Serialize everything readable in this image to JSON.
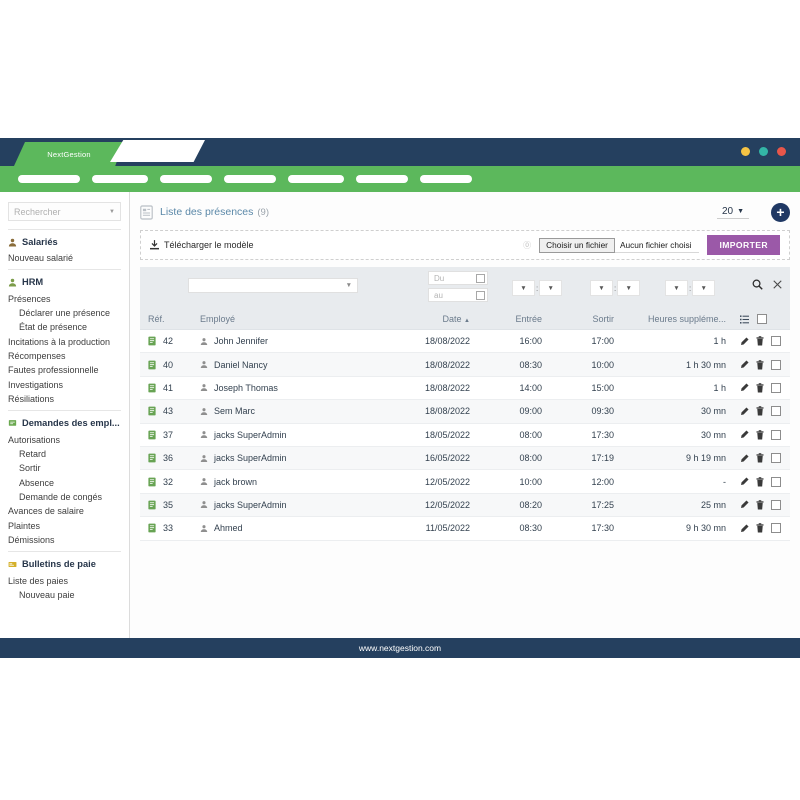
{
  "window": {
    "app_tab_label": "NextGestion",
    "dot_colors": [
      "#f5c344",
      "#33b5a6",
      "#e8564a"
    ],
    "titlebar_color": "#25405f",
    "navbar_color": "#5cb85c",
    "nav_pill_count": 7
  },
  "sidebar": {
    "search_placeholder": "Rechercher",
    "groups": [
      {
        "header": "Salariés",
        "icon": "person-icon",
        "items": [
          {
            "label": "Nouveau salarié",
            "indent": false
          }
        ]
      },
      {
        "header": "HRM",
        "icon": "person-icon",
        "items": [
          {
            "label": "Présences",
            "indent": false
          },
          {
            "label": "Déclarer une présence",
            "indent": true
          },
          {
            "label": "État de présence",
            "indent": true
          },
          {
            "label": "Incitations à la production",
            "indent": false
          },
          {
            "label": "Récompenses",
            "indent": false
          },
          {
            "label": "Fautes professionnelle",
            "indent": false
          },
          {
            "label": "Investigations",
            "indent": false
          },
          {
            "label": "Résiliations",
            "indent": false
          }
        ]
      },
      {
        "header": "Demandes des empl...",
        "icon": "flag-icon",
        "items": [
          {
            "label": "Autorisations",
            "indent": false
          },
          {
            "label": "Retard",
            "indent": true
          },
          {
            "label": "Sortir",
            "indent": true
          },
          {
            "label": "Absence",
            "indent": true
          },
          {
            "label": "Demande de congés",
            "indent": true
          },
          {
            "label": "Avances de salaire",
            "indent": false
          },
          {
            "label": "Plaintes",
            "indent": false
          },
          {
            "label": "Démissions",
            "indent": false
          }
        ]
      },
      {
        "header": "Bulletins de paie",
        "icon": "card-icon",
        "items": [
          {
            "label": "Liste des paies",
            "indent": false
          },
          {
            "label": "Nouveau paie",
            "indent": true
          }
        ]
      }
    ]
  },
  "page": {
    "title": "Liste des présences",
    "count": "(9)",
    "per_page": "20",
    "add_button_label": "+",
    "title_color": "#5b88a8"
  },
  "import_bar": {
    "download_template_label": "Télécharger le modèle",
    "choose_file_label": "Choisir un fichier",
    "no_file_label": "Aucun fichier choisi",
    "import_button_label": "IMPORTER",
    "import_button_color": "#9b59a8"
  },
  "filters": {
    "employee_select_value": "",
    "date_from_placeholder": "Du",
    "date_to_placeholder": "au",
    "time_groups": [
      {
        "name": "entree",
        "hour": "",
        "minute": ""
      },
      {
        "name": "sortir",
        "hour": "",
        "minute": ""
      },
      {
        "name": "heures-supp",
        "hour": "",
        "minute": ""
      }
    ],
    "search_icon": "search-icon",
    "clear_icon": "close-icon"
  },
  "table": {
    "columns": [
      "Réf.",
      "Employé",
      "Date",
      "Entrée",
      "Sortir",
      "Heures suppléme..."
    ],
    "sorted_column": "Date",
    "sort_direction": "asc",
    "rows": [
      {
        "ref": "42",
        "employee": "John Jennifer",
        "date": "18/08/2022",
        "entree": "16:00",
        "sortir": "17:00",
        "supp": "1 h"
      },
      {
        "ref": "40",
        "employee": "Daniel Nancy",
        "date": "18/08/2022",
        "entree": "08:30",
        "sortir": "10:00",
        "supp": "1 h 30 mn"
      },
      {
        "ref": "41",
        "employee": "Joseph Thomas",
        "date": "18/08/2022",
        "entree": "14:00",
        "sortir": "15:00",
        "supp": "1 h"
      },
      {
        "ref": "43",
        "employee": "Sem Marc",
        "date": "18/08/2022",
        "entree": "09:00",
        "sortir": "09:30",
        "supp": "30 mn"
      },
      {
        "ref": "37",
        "employee": "jacks SuperAdmin",
        "date": "18/05/2022",
        "entree": "08:00",
        "sortir": "17:30",
        "supp": "30 mn"
      },
      {
        "ref": "36",
        "employee": "jacks SuperAdmin",
        "date": "16/05/2022",
        "entree": "08:00",
        "sortir": "17:19",
        "supp": "9 h 19 mn"
      },
      {
        "ref": "32",
        "employee": "jack brown",
        "date": "12/05/2022",
        "entree": "10:00",
        "sortir": "12:00",
        "supp": "-"
      },
      {
        "ref": "35",
        "employee": "jacks SuperAdmin",
        "date": "12/05/2022",
        "entree": "08:20",
        "sortir": "17:25",
        "supp": "25 mn"
      },
      {
        "ref": "33",
        "employee": "Ahmed",
        "date": "11/05/2022",
        "entree": "08:30",
        "sortir": "17:30",
        "supp": "9 h 30 mn"
      }
    ]
  },
  "footer": {
    "url": "www.nextgestion.com"
  }
}
